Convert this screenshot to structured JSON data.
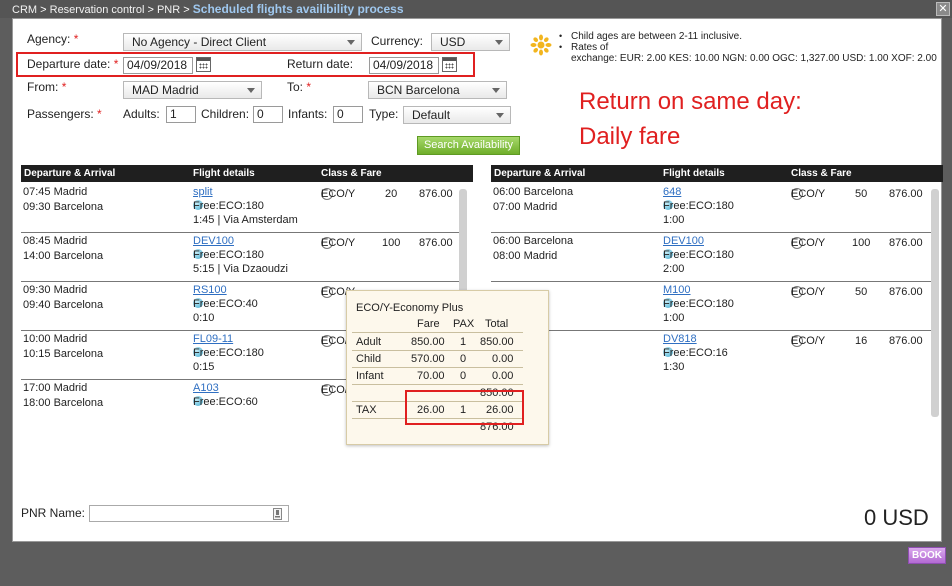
{
  "breadcrumb": {
    "crm": "CRM",
    "sep": ">",
    "reservation": "Reservation control",
    "pnr": "PNR",
    "title": "Scheduled flights availibility process"
  },
  "window": {
    "close_label": "✕"
  },
  "form": {
    "agency_label": "Agency:",
    "agency_value": "No Agency - Direct Client",
    "currency_label": "Currency:",
    "currency_value": "USD",
    "departure_label": "Departure date:",
    "departure_value": "04/09/2018",
    "return_label": "Return date:",
    "return_value": "04/09/2018",
    "from_label": "From:",
    "from_value": "MAD  Madrid",
    "to_label": "To:",
    "to_value": "BCN  Barcelona",
    "passengers_label": "Passengers:",
    "adults_label": "Adults:",
    "adults_value": "1",
    "children_label": "Children:",
    "children_value": "0",
    "infants_label": "Infants:",
    "infants_value": "0",
    "type_label": "Type:",
    "type_value": "Default",
    "required_mark": "*",
    "search_button": "Search Availability"
  },
  "info": {
    "bullet": "•",
    "child_ages": "Child ages are between 2-11 inclusive.",
    "rates_label": "Rates of",
    "rates_exchange": "exchange: EUR: 2.00  KES: 10.00  NGN: 0.00  OGC: 1,327.00  USD: 1.00  XOF: 2.00"
  },
  "annotation": {
    "line1": "Return on same day:",
    "line2": "Daily fare"
  },
  "table_headers": {
    "departure": "Departure & Arrival",
    "flight": "Flight details",
    "class": "Class & Fare"
  },
  "outbound": [
    {
      "dep": "07:45 Madrid",
      "arr": "09:30 Barcelona",
      "flight": "split",
      "free": "Free:ECO:180",
      "dur": "1:45 | Via Amsterdam",
      "class": "ECO/Y",
      "seats": "20",
      "fare": "876.00"
    },
    {
      "dep": "08:45 Madrid",
      "arr": "14:00 Barcelona",
      "flight": "DEV100",
      "free": "Free:ECO:180",
      "dur": "5:15 | Via Dzaoudzi",
      "class": "ECO/Y",
      "seats": "100",
      "fare": "876.00"
    },
    {
      "dep": "09:30 Madrid",
      "arr": "09:40 Barcelona",
      "flight": "RS100",
      "free": "Free:ECO:40",
      "dur": "0:10",
      "class": "ECO/Y",
      "seats": "",
      "fare": ""
    },
    {
      "dep": "10:00 Madrid",
      "arr": "10:15 Barcelona",
      "flight": "FL09-11",
      "free": "Free:ECO:180",
      "dur": "0:15",
      "class": "ECO/Y",
      "seats": "",
      "fare": ""
    },
    {
      "dep": "17:00 Madrid",
      "arr": "18:00 Barcelona",
      "flight": "A103",
      "free": "Free:ECO:60",
      "dur": "",
      "class": "ECO/Y",
      "seats": "",
      "fare": ""
    }
  ],
  "inbound": [
    {
      "dep": "06:00 Barcelona",
      "arr": "07:00 Madrid",
      "flight": "648",
      "free": "Free:ECO:180",
      "dur": "1:00",
      "class": "ECO/Y",
      "seats": "50",
      "fare": "876.00"
    },
    {
      "dep": "06:00 Barcelona",
      "arr": "08:00 Madrid",
      "flight": "DEV100",
      "free": "Free:ECO:180",
      "dur": "2:00",
      "class": "ECO/Y",
      "seats": "100",
      "fare": "876.00"
    },
    {
      "dep": "",
      "arr": "",
      "flight": "M100",
      "free": "Free:ECO:180",
      "dur": "1:00",
      "class": "ECO/Y",
      "seats": "50",
      "fare": "876.00"
    },
    {
      "dep": "",
      "arr": "",
      "flight": "DV818",
      "free": "Free:ECO:16",
      "dur": "1:30",
      "class": "ECO/Y",
      "seats": "16",
      "fare": "876.00"
    }
  ],
  "fare_popup": {
    "title": "ECO/Y-Economy Plus",
    "headers": [
      "Fare",
      "PAX",
      "Total"
    ],
    "rows": [
      {
        "label": "Adult",
        "fare": "850.00",
        "pax": "1",
        "total": "850.00"
      },
      {
        "label": "Child",
        "fare": "570.00",
        "pax": "0",
        "total": "0.00"
      },
      {
        "label": "Infant",
        "fare": "70.00",
        "pax": "0",
        "total": "0.00"
      }
    ],
    "subtotal": "850.00",
    "tax": {
      "label": "TAX",
      "fare": "26.00",
      "pax": "1",
      "total": "26.00"
    },
    "grand_total": "876.00"
  },
  "footer": {
    "pnr_label": "PNR Name:",
    "total": "0 USD",
    "book_button": "BOOK"
  }
}
